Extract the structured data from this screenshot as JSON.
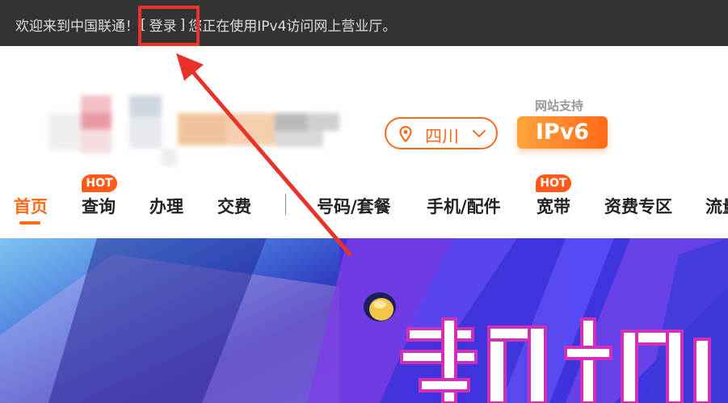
{
  "topbar": {
    "welcome": "欢迎来到中国联通！",
    "login_open": "[",
    "login_label": "登录",
    "login_close": "]",
    "notice": "您正在使用IPv4访问网上营业厅。"
  },
  "location": {
    "city": "四川"
  },
  "ipv6_badge": {
    "support_text": "网站支持",
    "label": "IPv6"
  },
  "nav": {
    "items": [
      {
        "label": "首页",
        "active": true
      },
      {
        "label": "查询",
        "hot": "HOT"
      },
      {
        "label": "办理"
      },
      {
        "label": "交费"
      },
      {
        "label": "号码/套餐"
      },
      {
        "label": "手机/配件"
      },
      {
        "label": "宽带",
        "hot": "HOT"
      },
      {
        "label": "资费专区"
      },
      {
        "label": "流量"
      }
    ]
  },
  "colors": {
    "accent": "#ff6a1a",
    "topbar_bg": "#333333",
    "highlight_red": "#e8332a"
  }
}
